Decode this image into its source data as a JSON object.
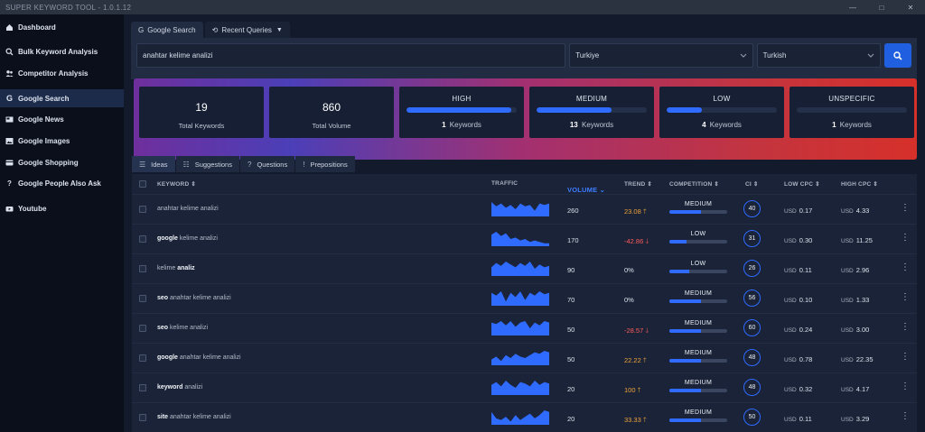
{
  "app": {
    "title": "SUPER KEYWORD TOOL - 1.0.1.12"
  },
  "window_controls": [
    "—",
    "□",
    "✕"
  ],
  "sidebar": {
    "items": [
      {
        "label": "Dashboard",
        "icon": "home-icon"
      },
      {
        "label": "Bulk Keyword Analysis",
        "icon": "search-icon"
      },
      {
        "label": "Competitor Analysis",
        "icon": "users-icon"
      },
      {
        "label": "Google Search",
        "icon": "google-icon",
        "active": true
      },
      {
        "label": "Google News",
        "icon": "news-icon"
      },
      {
        "label": "Google Images",
        "icon": "image-icon"
      },
      {
        "label": "Google Shopping",
        "icon": "shopping-icon"
      },
      {
        "label": "Google People Also Ask",
        "icon": "question-icon"
      },
      {
        "label": "Youtube",
        "icon": "youtube-icon"
      }
    ]
  },
  "search": {
    "tabs": [
      {
        "label": "Google Search",
        "icon": "G"
      },
      {
        "label": "Recent Queries",
        "icon": "⟲"
      }
    ],
    "query": "anahtar kelime analizi",
    "country": "Turkiye",
    "language": "Turkish"
  },
  "stats": {
    "total_keywords": {
      "value": "19",
      "label": "Total Keywords"
    },
    "total_volume": {
      "value": "860",
      "label": "Total Volume"
    },
    "levels": [
      {
        "name": "HIGH",
        "count": "1",
        "suffix": "Keywords",
        "fill": 0.95
      },
      {
        "name": "MEDIUM",
        "count": "13",
        "suffix": "Keywords",
        "fill": 0.68
      },
      {
        "name": "LOW",
        "count": "4",
        "suffix": "Keywords",
        "fill": 0.32
      },
      {
        "name": "UNSPECIFIC",
        "count": "1",
        "suffix": "Keywords",
        "fill": 0.0
      }
    ]
  },
  "result_tabs": [
    {
      "label": "Ideas",
      "icon": "☰",
      "active": true
    },
    {
      "label": "Suggestions",
      "icon": "☷"
    },
    {
      "label": "Questions",
      "icon": "?"
    },
    {
      "label": "Prepositions",
      "icon": "!"
    }
  ],
  "table": {
    "headers": {
      "keyword": "KEYWORD",
      "traffic": "TRAFFIC",
      "volume": "VOLUME",
      "trend": "TREND",
      "competition": "COMPETITION",
      "ci": "CI",
      "low_cpc": "LOW CPC",
      "high_cpc": "HIGH CPC"
    },
    "currency": "USD",
    "rows": [
      {
        "keyword": [
          [
            "anahtar kelime analizi",
            false
          ]
        ],
        "spark": [
          10,
          7,
          9,
          6,
          8,
          5,
          9,
          7,
          8,
          4,
          9,
          8,
          9
        ],
        "volume": "260",
        "trend": "23.08",
        "trend_dir": "up",
        "competition": "MEDIUM",
        "comp_fill": 0.55,
        "ci": "40",
        "low_cpc": "0.17",
        "high_cpc": "4.33"
      },
      {
        "keyword": [
          [
            "google",
            true
          ],
          [
            " kelime analizi",
            false
          ]
        ],
        "spark": [
          8,
          10,
          7,
          9,
          5,
          6,
          4,
          5,
          3,
          4,
          3,
          2,
          2
        ],
        "volume": "170",
        "trend": "-42.86",
        "trend_dir": "down",
        "competition": "LOW",
        "comp_fill": 0.3,
        "ci": "31",
        "low_cpc": "0.30",
        "high_cpc": "11.25"
      },
      {
        "keyword": [
          [
            "kelime ",
            false
          ],
          [
            "analiz",
            true
          ]
        ],
        "spark": [
          6,
          9,
          7,
          10,
          8,
          6,
          9,
          7,
          10,
          5,
          8,
          6,
          7
        ],
        "volume": "90",
        "trend": "0%",
        "trend_dir": "flat",
        "competition": "LOW",
        "comp_fill": 0.35,
        "ci": "26",
        "low_cpc": "0.11",
        "high_cpc": "2.96"
      },
      {
        "keyword": [
          [
            "seo",
            true
          ],
          [
            " anahtar kelime analizi",
            false
          ]
        ],
        "spark": [
          9,
          7,
          10,
          3,
          9,
          6,
          10,
          4,
          9,
          7,
          10,
          8,
          9
        ],
        "volume": "70",
        "trend": "0%",
        "trend_dir": "flat",
        "competition": "MEDIUM",
        "comp_fill": 0.55,
        "ci": "56",
        "low_cpc": "0.10",
        "high_cpc": "1.33"
      },
      {
        "keyword": [
          [
            "seo",
            true
          ],
          [
            " kelime analizi",
            false
          ]
        ],
        "spark": [
          9,
          8,
          10,
          7,
          10,
          6,
          9,
          10,
          5,
          9,
          7,
          10,
          9
        ],
        "volume": "50",
        "trend": "-28.57",
        "trend_dir": "down",
        "competition": "MEDIUM",
        "comp_fill": 0.55,
        "ci": "60",
        "low_cpc": "0.24",
        "high_cpc": "3.00"
      },
      {
        "keyword": [
          [
            "google",
            true
          ],
          [
            " anahtar kelime analizi",
            false
          ]
        ],
        "spark": [
          4,
          6,
          3,
          7,
          5,
          8,
          6,
          5,
          7,
          9,
          8,
          10,
          9
        ],
        "volume": "50",
        "trend": "22.22",
        "trend_dir": "up",
        "competition": "MEDIUM",
        "comp_fill": 0.55,
        "ci": "48",
        "low_cpc": "0.78",
        "high_cpc": "22.35"
      },
      {
        "keyword": [
          [
            "keyword",
            true
          ],
          [
            " analizi",
            false
          ]
        ],
        "spark": [
          7,
          9,
          6,
          10,
          7,
          5,
          9,
          8,
          6,
          10,
          7,
          9,
          8
        ],
        "volume": "20",
        "trend": "100",
        "trend_dir": "up",
        "competition": "MEDIUM",
        "comp_fill": 0.55,
        "ci": "48",
        "low_cpc": "0.32",
        "high_cpc": "4.17"
      },
      {
        "keyword": [
          [
            "site",
            true
          ],
          [
            " anahtar kelime analizi",
            false
          ]
        ],
        "spark": [
          8,
          4,
          3,
          5,
          2,
          6,
          3,
          5,
          7,
          4,
          6,
          9,
          8
        ],
        "volume": "20",
        "trend": "33.33",
        "trend_dir": "up",
        "competition": "MEDIUM",
        "comp_fill": 0.55,
        "ci": "50",
        "low_cpc": "0.11",
        "high_cpc": "3.29"
      }
    ]
  },
  "colors": {
    "accent": "#2f6bff",
    "trend_up": "#f0a43a",
    "trend_down": "#ff5b5b",
    "sidebar_bg": "#0b0f1c",
    "main_bg": "#121a2b"
  }
}
